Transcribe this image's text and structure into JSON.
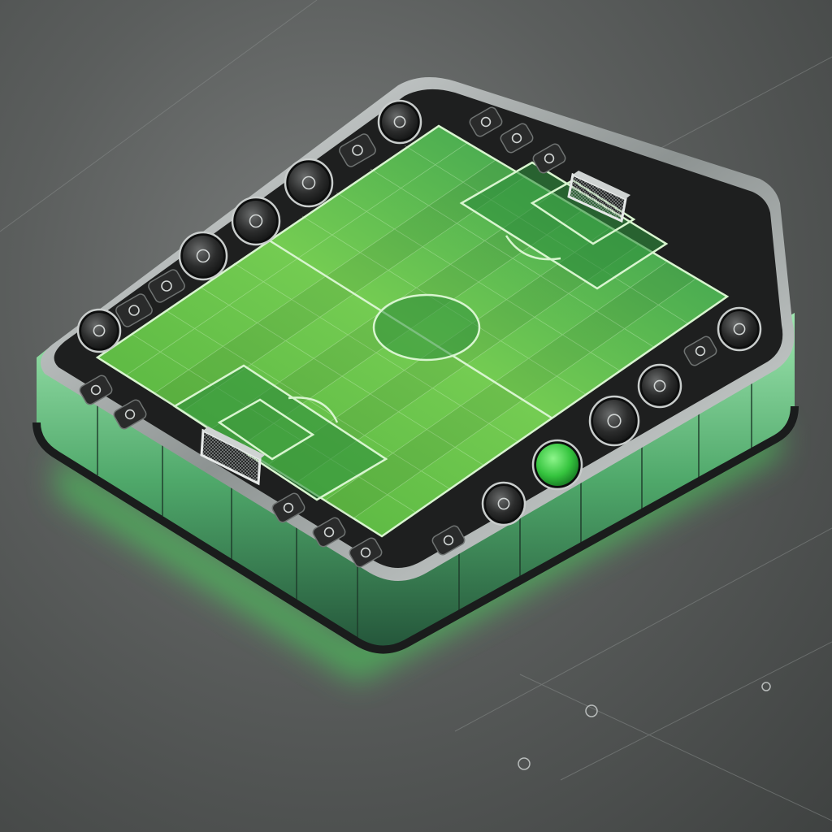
{
  "colors": {
    "background": "#5b5e5d",
    "bezel": "#1e1f1f",
    "chrome_rim": "#c9cdcc",
    "pitch_dark": "#2f8f3c",
    "pitch_light": "#6cc74a",
    "pitch_line": "#d8f5cf",
    "side_glow": "#57d86a",
    "active_button": "#3fcf4c",
    "button_face": "#2a2b2b"
  },
  "board": {
    "pitch": "football-pitch",
    "goals": [
      "goal-net",
      "goal-net"
    ]
  },
  "buttons": [
    {
      "icon": "target-icon",
      "state": "idle"
    },
    {
      "icon": "glyph-icon",
      "state": "idle"
    },
    {
      "icon": "glyph-icon",
      "state": "idle"
    },
    {
      "icon": "target-icon",
      "state": "idle"
    },
    {
      "icon": "target-icon",
      "state": "idle"
    },
    {
      "icon": "target-icon",
      "state": "idle"
    },
    {
      "icon": "glyph-icon",
      "state": "idle"
    },
    {
      "icon": "target-icon",
      "state": "idle"
    },
    {
      "icon": "glyph-icon",
      "state": "idle"
    },
    {
      "icon": "glyph-icon",
      "state": "idle"
    },
    {
      "icon": "glyph-icon",
      "state": "idle"
    },
    {
      "icon": "target-icon",
      "state": "idle"
    },
    {
      "icon": "glyph-icon",
      "state": "idle"
    },
    {
      "icon": "target-icon",
      "state": "idle"
    },
    {
      "icon": "target-icon",
      "state": "idle"
    },
    {
      "icon": "record-button",
      "state": "active"
    },
    {
      "icon": "target-icon",
      "state": "idle"
    },
    {
      "icon": "glyph-icon",
      "state": "idle"
    },
    {
      "icon": "glyph-icon",
      "state": "idle"
    },
    {
      "icon": "glyph-icon",
      "state": "idle"
    },
    {
      "icon": "glyph-icon",
      "state": "idle"
    },
    {
      "icon": "glyph-icon",
      "state": "idle"
    },
    {
      "icon": "glyph-icon",
      "state": "idle"
    }
  ]
}
